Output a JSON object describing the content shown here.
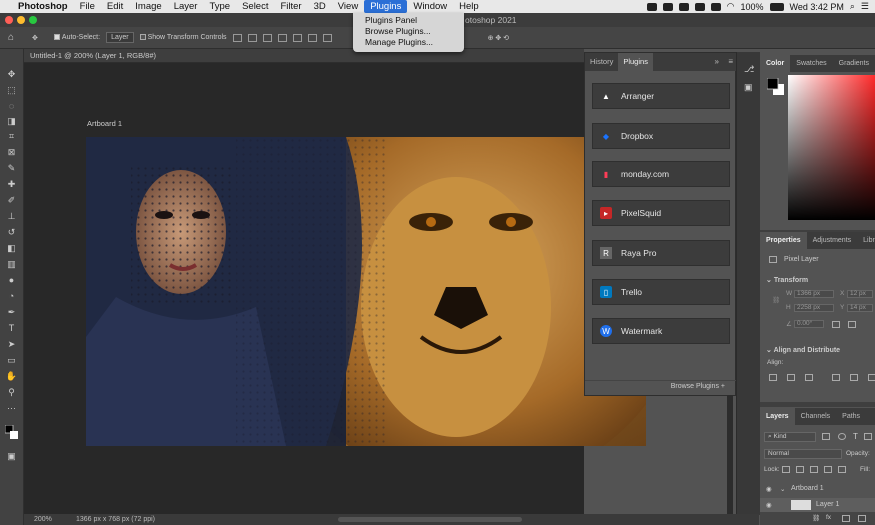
{
  "menubar": {
    "app": "Photoshop",
    "items": [
      "File",
      "Edit",
      "Image",
      "Layer",
      "Type",
      "Select",
      "Filter",
      "3D",
      "View",
      "Plugins",
      "Window",
      "Help"
    ],
    "active": "Plugins",
    "battery": "100%",
    "clock": "Wed 3:42 PM"
  },
  "title_partial": "otoshop 2021",
  "plugins_menu": [
    "Plugins Panel",
    "Browse Plugins...",
    "Manage Plugins..."
  ],
  "options": {
    "auto_select": "Auto-Select:",
    "auto_select_value": "Layer",
    "transform_controls": "Show Transform Controls"
  },
  "document": {
    "tab": "Untitled-1 @ 200% (Layer 1, RGB/8#)",
    "artboard": "Artboard 1"
  },
  "status": {
    "zoom": "200%",
    "dims": "1366 px x 768 px (72 ppi)"
  },
  "plugin_panel": {
    "tabs": [
      "History",
      "Plugins"
    ],
    "plugins": [
      {
        "name": "Arranger",
        "icon": "arranger-icon",
        "color": "#3c3c3c"
      },
      {
        "name": "Dropbox",
        "icon": "dropbox-icon",
        "color": "#0061ff"
      },
      {
        "name": "monday.com",
        "icon": "monday-icon",
        "color": "#ff3d57"
      },
      {
        "name": "PixelSquid",
        "icon": "pixelsquid-icon",
        "color": "#d42a2a"
      },
      {
        "name": "Raya Pro",
        "icon": "raya-icon",
        "color": "#555555"
      },
      {
        "name": "Trello",
        "icon": "trello-icon",
        "color": "#0079bf"
      },
      {
        "name": "Watermark",
        "icon": "watermark-icon",
        "color": "#1f6feb"
      }
    ],
    "browse": "Browse Plugins"
  },
  "color_panel": {
    "tabs": [
      "Color",
      "Swatches",
      "Gradients"
    ]
  },
  "properties": {
    "tabs": [
      "Properties",
      "Adjustments",
      "Libra"
    ],
    "kind": "Pixel Layer",
    "transform": "Transform",
    "w": "W",
    "w_val": "1366 px",
    "h": "H",
    "h_val": "2258 px",
    "x": "X",
    "x_val": "12 px",
    "y": "Y",
    "y_val": "14 px",
    "angle": "0.00°",
    "align": "Align and Distribute",
    "align_sub": "Align:"
  },
  "layers": {
    "tabs": [
      "Layers",
      "Channels",
      "Paths"
    ],
    "filter": "Kind",
    "blend": "Normal",
    "opacity": "Opacity:",
    "lock": "Lock:",
    "fill": "Fill:",
    "rows": [
      "Artboard 1",
      "Layer 1"
    ]
  }
}
